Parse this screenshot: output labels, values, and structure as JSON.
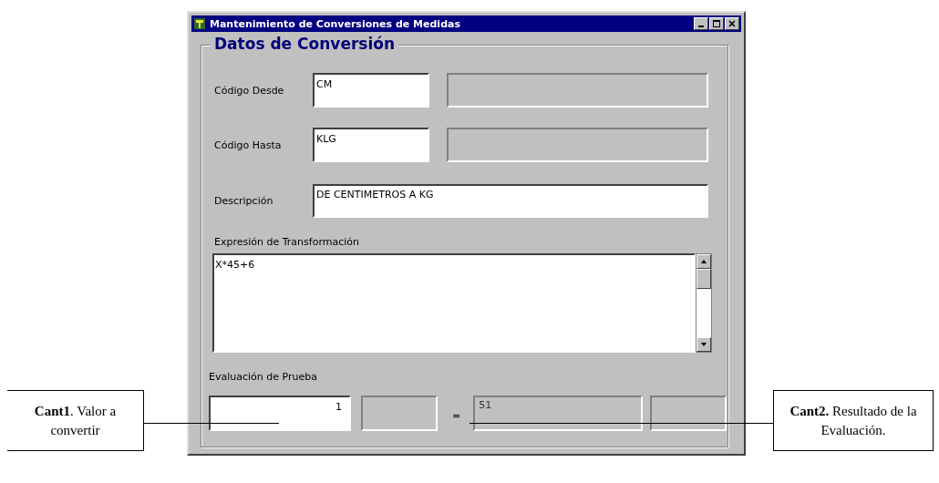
{
  "window": {
    "title": "Mantenimiento de Conversiones de Medidas"
  },
  "group": {
    "title": "Datos de Conversión"
  },
  "codigo_desde": {
    "label": "Código Desde",
    "value": "CM"
  },
  "codigo_hasta": {
    "label": "Código Hasta",
    "value": "KLG"
  },
  "descripcion": {
    "label": "Descripción",
    "value": "DE CENTIMETROS A KG"
  },
  "expresion": {
    "label": "Expresión de Transformación",
    "value": "X*45+6"
  },
  "evaluacion": {
    "label": "Evaluación de Prueba",
    "input": "1",
    "operator": "=",
    "result": "51"
  },
  "annotations": [
    {
      "text": "**Cant1**.  Valor a convertir"
    },
    {
      "text": "**Cant2.** Resultado de la Evaluación."
    }
  ]
}
